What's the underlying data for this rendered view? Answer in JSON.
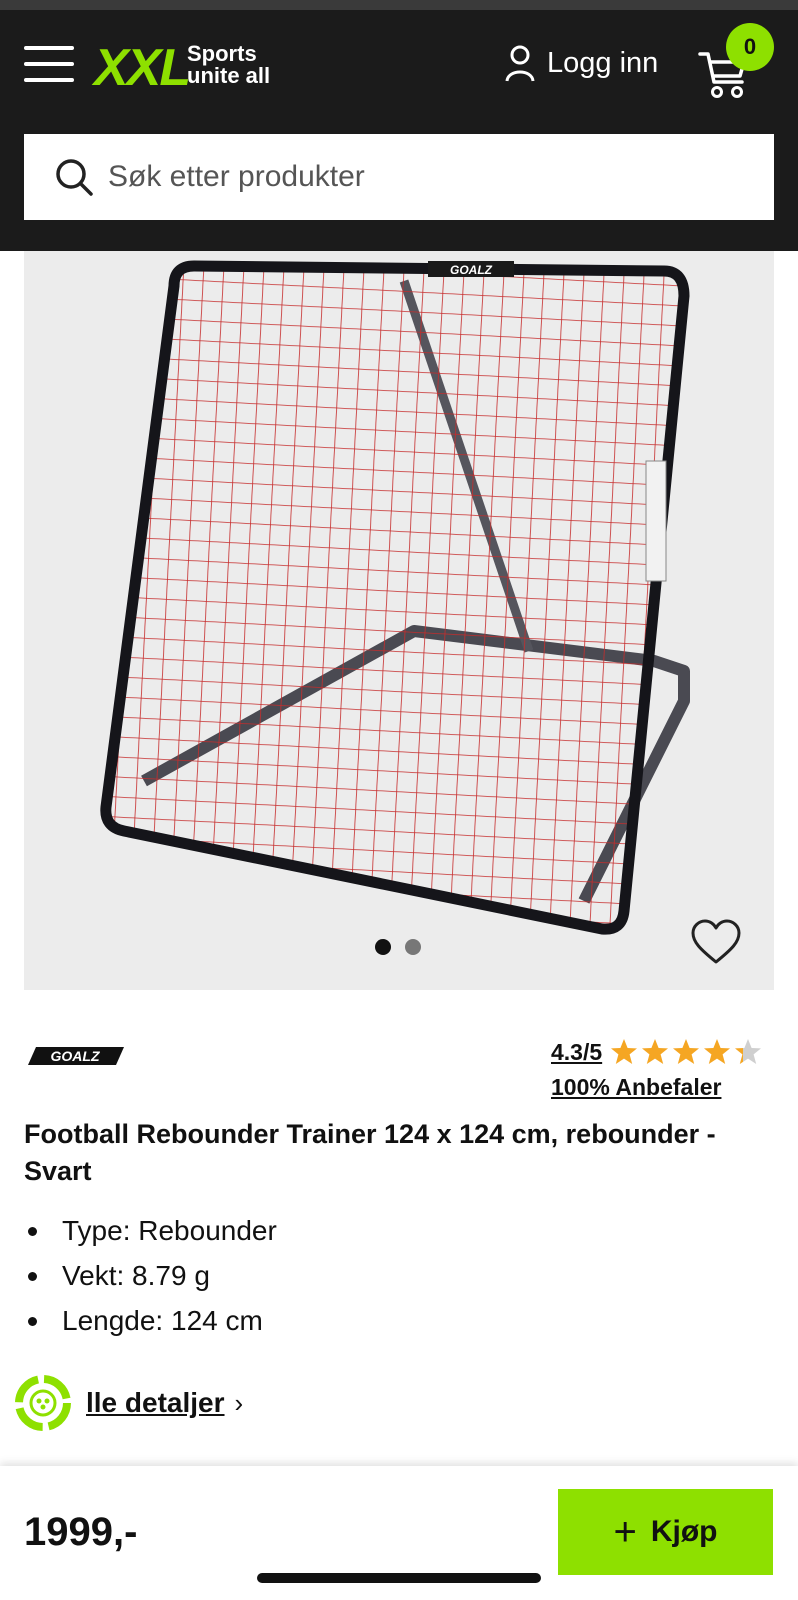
{
  "header": {
    "logo_text": "XXL",
    "logo_tagline_line1": "Sports",
    "logo_tagline_line2": "unite all",
    "login_label": "Logg inn",
    "cart_count": "0",
    "search_placeholder": "Søk etter produkter",
    "colors": {
      "background": "#1b1b1b",
      "accent": "#8ee000"
    }
  },
  "gallery": {
    "image_subject": "Football rebounder net with black frame and red net",
    "image_brand_mark": "GOALZ",
    "dot_count": 2,
    "active_dot": 1
  },
  "product": {
    "brand_logo_text": "GOALZ",
    "rating": "4.3/5",
    "rating_value": 4.3,
    "rating_max": 5,
    "recommend": "100% Anbefaler",
    "title": "Football Rebounder Trainer 124 x 124 cm, rebounder - Svart",
    "specs": [
      "Type: Rebounder",
      "Vekt: 8.79 g",
      "Lengde: 124 cm"
    ],
    "details_link": "lle detaljer",
    "price": "1999,-",
    "buy_label": "Kjøp"
  }
}
